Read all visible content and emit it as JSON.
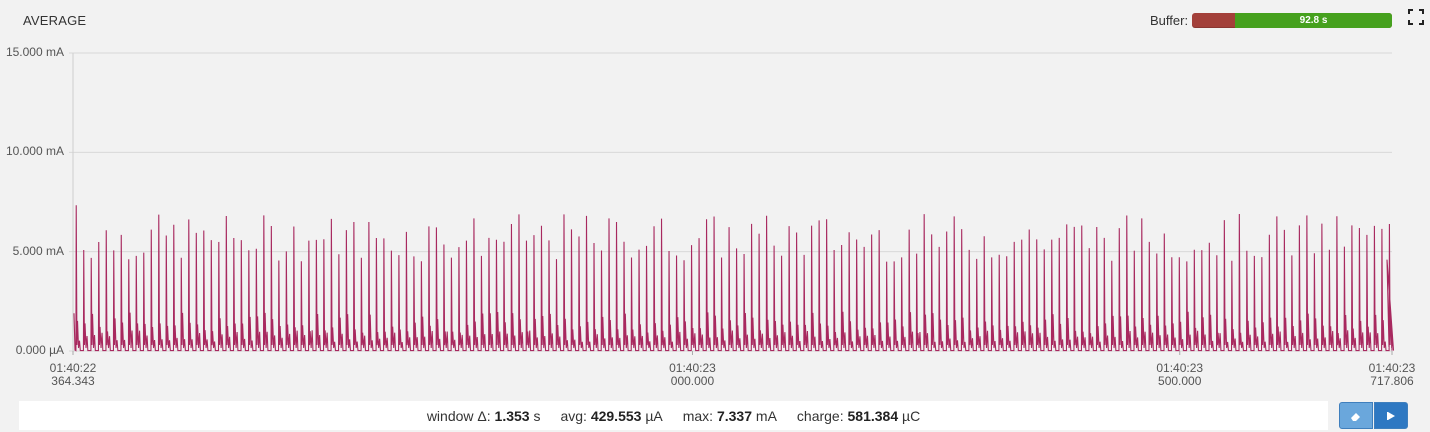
{
  "header": {
    "title": "AVERAGE",
    "buffer_label": "Buffer:",
    "buffer_value": "92.8 s",
    "buffer_fraction": 0.785
  },
  "toolbar": {
    "fullscreen_icon": "fullscreen-icon",
    "clear_icon": "eraser-icon",
    "live_icon": "play-icon"
  },
  "chart_data": {
    "type": "line",
    "title": "AVERAGE",
    "yaxis_ticks": [
      "15.000 mA",
      "10.000 mA",
      "5.000 mA",
      "0.000 µA"
    ],
    "ylim_mA": [
      0,
      15
    ],
    "xaxis_ticks": [
      {
        "time": "01:40:22",
        "ms": "364.343"
      },
      {
        "time": "01:40:23",
        "ms": "000.000"
      },
      {
        "time": "01:40:23",
        "ms": "500.000"
      },
      {
        "time": "01:40:23",
        "ms": "717.806"
      }
    ],
    "x_start_s": 0.364343,
    "x_end_s": 1.717806,
    "grid": true,
    "series": [
      {
        "color": "#a8295f",
        "peak_period_s": 0.0077,
        "peak_max_mA": 7.337,
        "peak_typical_mA": [
          4.5,
          6.9
        ],
        "secondary_peak_mA": [
          0.9,
          2.0
        ],
        "baseline_mA": 0.0
      }
    ]
  },
  "stats": {
    "window_label": "window Δ:",
    "window_value": "1.353",
    "window_unit": "s",
    "avg_label": "avg:",
    "avg_value": "429.553",
    "avg_unit": "µA",
    "max_label": "max:",
    "max_value": "7.337",
    "max_unit": "mA",
    "charge_label": "charge:",
    "charge_value": "581.384",
    "charge_unit": "µC"
  }
}
